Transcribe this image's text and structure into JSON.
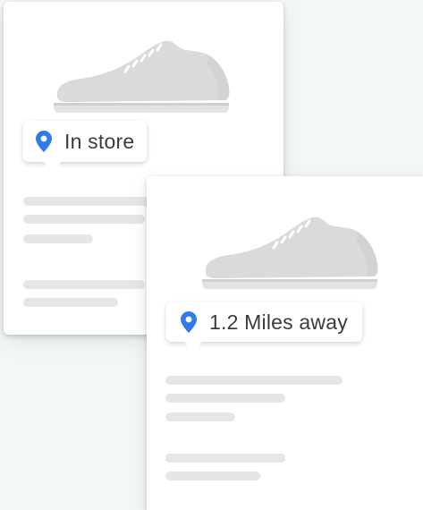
{
  "cards": [
    {
      "image_icon": "sneaker-icon",
      "tag": {
        "icon": "location-pin-icon",
        "label": "In store"
      }
    },
    {
      "image_icon": "sneaker-icon",
      "tag": {
        "icon": "location-pin-icon",
        "label": "1.2 Miles away"
      }
    }
  ],
  "colors": {
    "background": "#f3f7f7",
    "card": "#ffffff",
    "placeholder": "#e6e6e6",
    "shoe": "#d9d9d9",
    "pin": "#2f7bed",
    "text": "#3b3b3b"
  }
}
